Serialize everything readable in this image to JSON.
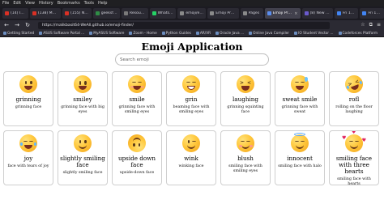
{
  "browser": {
    "menu": [
      "File",
      "Edit",
      "View",
      "History",
      "Bookmarks",
      "Tools",
      "Help"
    ],
    "tabs": [
      {
        "label": "(14) Inb...",
        "color": "#d93025"
      },
      {
        "label": "(138) Meta...",
        "color": "#d93025"
      },
      {
        "label": "(155) Nav...",
        "color": "#d93025"
      },
      {
        "label": "geeksfor...",
        "color": "#2f8d46"
      },
      {
        "label": "Resources",
        "color": "#7a7a7a"
      },
      {
        "label": "WhatsApp",
        "color": "#25d366"
      },
      {
        "label": "emoji/em...",
        "color": "#24292f"
      },
      {
        "label": "Emoji Project",
        "color": "#24292f"
      },
      {
        "label": "Pages",
        "color": "#24292f"
      },
      {
        "label": "Emoji Project",
        "color": "#5a8dee",
        "active": true
      },
      {
        "label": "(8) New Ch...",
        "color": "#6a5acd"
      },
      {
        "label": "Fri 14 Jul",
        "color": "#4285f4"
      },
      {
        "label": "Fri 14 Jul",
        "color": "#4285f4"
      },
      {
        "label": "Emoji Proj...",
        "color": "#5a8dee"
      }
    ],
    "url": "https://malikbasit64-WeAll.github.io/emoji-finder/",
    "bookmarks": [
      "Getting Started",
      "ASUS Software Portal ...",
      "MyASUS Software",
      "Zoom - Home",
      "Python Guides",
      "AR/VR",
      "Oracle Java ...",
      "Online Java Compiler",
      "IO Student Vector ...",
      "Codeforces Platform",
      "Hackerrank",
      "Calendar | Fortu Factory"
    ]
  },
  "page": {
    "title": "Emoji Application",
    "search_placeholder": "Search emoji"
  },
  "emojis": [
    {
      "name": "grinning",
      "desc": "grinning face"
    },
    {
      "name": "smiley",
      "desc": "grinning face with big eyes"
    },
    {
      "name": "smile",
      "desc": "grinning face with smiling eyes"
    },
    {
      "name": "grin",
      "desc": "beaming face with smiling eyes"
    },
    {
      "name": "laughing",
      "desc": "grinning squinting face"
    },
    {
      "name": "sweat smile",
      "desc": "grinning face with sweat"
    },
    {
      "name": "rofl",
      "desc": "rolling on the floor laughing"
    },
    {
      "name": "joy",
      "desc": "face with tears of joy"
    },
    {
      "name": "slightly smiling face",
      "desc": "slightly smiling face"
    },
    {
      "name": "upside down face",
      "desc": "upside-down face"
    },
    {
      "name": "wink",
      "desc": "winking face"
    },
    {
      "name": "blush",
      "desc": "smiling face with smiling eyes"
    },
    {
      "name": "innocent",
      "desc": "smiling face with halo"
    },
    {
      "name": "smiling face with three hearts",
      "desc": "smiling face with hearts"
    }
  ]
}
